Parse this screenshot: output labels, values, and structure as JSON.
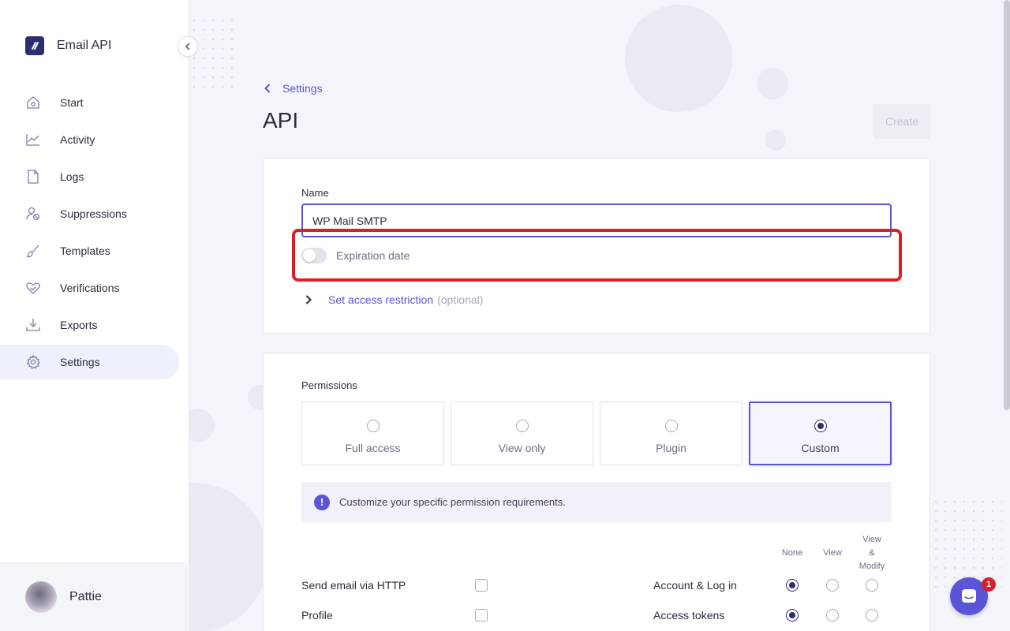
{
  "brand": {
    "name": "Email API"
  },
  "sidebar": {
    "items": [
      {
        "label": "Start",
        "icon": "home-icon"
      },
      {
        "label": "Activity",
        "icon": "chart-line-icon"
      },
      {
        "label": "Logs",
        "icon": "file-icon"
      },
      {
        "label": "Suppressions",
        "icon": "user-block-icon"
      },
      {
        "label": "Templates",
        "icon": "brush-icon"
      },
      {
        "label": "Verifications",
        "icon": "heart-check-icon"
      },
      {
        "label": "Exports",
        "icon": "download-icon"
      },
      {
        "label": "Settings",
        "icon": "gear-icon",
        "active": true
      }
    ]
  },
  "user": {
    "name": "Pattie"
  },
  "breadcrumb": {
    "label": "Settings"
  },
  "page": {
    "title": "API",
    "create_label": "Create"
  },
  "form": {
    "name_label": "Name",
    "name_value": "WP Mail SMTP",
    "expiration_label": "Expiration date",
    "access_link": "Set access restriction",
    "access_optional": "(optional)"
  },
  "permissions": {
    "title": "Permissions",
    "options": [
      "Full access",
      "View only",
      "Plugin",
      "Custom"
    ],
    "selected": "Custom",
    "info": "Customize your specific permission requirements.",
    "columns": {
      "none": "None",
      "view": "View",
      "view_modify_1": "View",
      "view_modify_2": "&",
      "view_modify_3": "Modify"
    },
    "rows_left": [
      "Send email via HTTP",
      "Profile"
    ],
    "rows_right": [
      "Account & Log in",
      "Access tokens"
    ]
  },
  "chat": {
    "badge": "1"
  },
  "colors": {
    "accent": "#5b54d6",
    "highlight": "#dc1f26",
    "brand": "#2d2e6e"
  }
}
